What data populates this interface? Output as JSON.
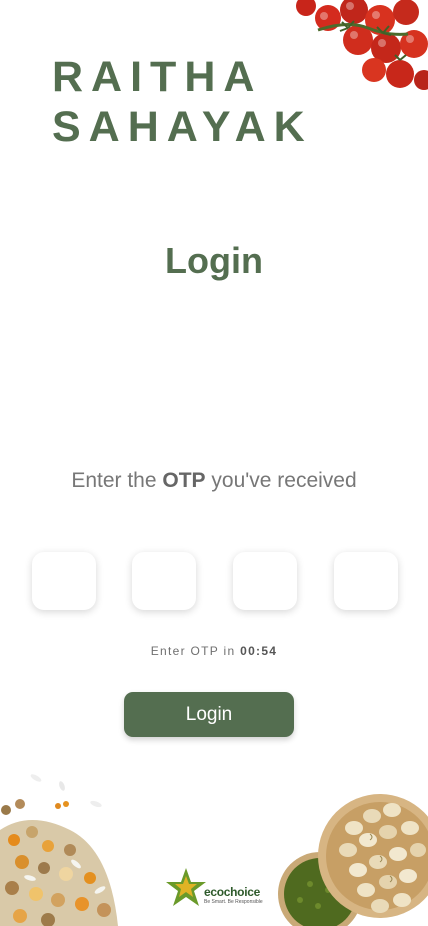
{
  "brand": {
    "line1": "RAITHA",
    "line2": "SAHAYAK",
    "color": "#546e50"
  },
  "page_title": "Login",
  "otp": {
    "prompt_prefix": "Enter the",
    "prompt_bold": "OTP",
    "prompt_suffix": "you've received",
    "digits": [
      "",
      "",
      "",
      ""
    ],
    "timer_prefix": "Enter OTP in",
    "timer_value": "00:54"
  },
  "login_button": {
    "label": "Login",
    "color": "#546e50"
  },
  "footer_logo": {
    "name": "ecochoice",
    "tagline": "Be Smart. Be Responsible"
  },
  "decorations": [
    "tomatoes-image",
    "grains-image",
    "pistachio-bowl-image",
    "mung-bean-bowl-image"
  ]
}
